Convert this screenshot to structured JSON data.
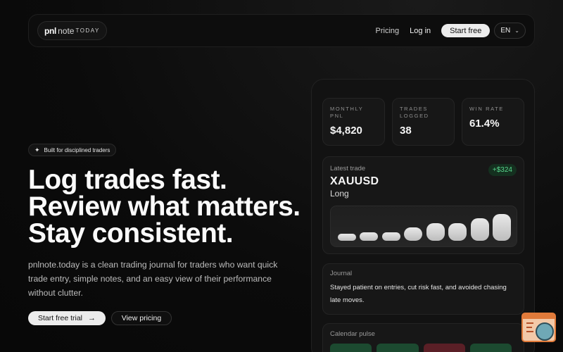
{
  "nav": {
    "logo": {
      "pnl": "pnl",
      "note": "note",
      "today": "TODAY"
    },
    "pricing": "Pricing",
    "login": "Log in",
    "start_free": "Start free",
    "language": "EN"
  },
  "hero": {
    "badge": "Built for disciplined traders",
    "headline": [
      "Log trades fast.",
      "Review what matters.",
      "Stay consistent."
    ],
    "subtext": "pnlnote.today is a clean trading journal for traders who want quick trade entry, simple notes, and an easy view of their performance without clutter.",
    "cta_primary": "Start free trial",
    "cta_secondary": "View pricing"
  },
  "dashboard": {
    "stats": [
      {
        "label": "MONTHLY PNL",
        "value": "$4,820"
      },
      {
        "label": "TRADES LOGGED",
        "value": "38"
      },
      {
        "label": "WIN RATE",
        "value": "61.4%"
      }
    ],
    "latest": {
      "label": "Latest trade",
      "symbol": "XAUUSD",
      "direction": "Long",
      "pnl": "+$324",
      "pnl_color": "#58d68d",
      "bar_levels": [
        0.15,
        0.2,
        0.2,
        0.33,
        0.43,
        0.43,
        0.55,
        0.65
      ]
    },
    "journal": {
      "label": "Journal",
      "text": "Stayed patient on entries, cut risk fast, and avoided chasing late moves."
    },
    "calendar": {
      "label": "Calendar pulse",
      "cells": [
        {
          "status": "win",
          "color": "#1c4a30"
        },
        {
          "status": "win",
          "color": "#1c4a30"
        },
        {
          "status": "loss",
          "color": "#5a1f26"
        },
        {
          "status": "win",
          "color": "#1c4a30"
        }
      ]
    }
  },
  "icons": {
    "badge_icon": "sparkle-icon",
    "lang_icon": "chevron-down-icon",
    "cta_icon": "arrow-right-icon",
    "corner_widget": "assistant-widget-icon"
  }
}
